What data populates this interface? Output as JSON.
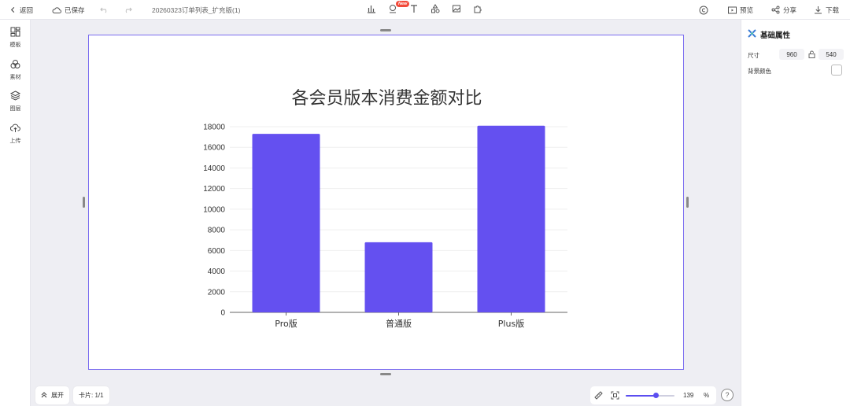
{
  "topbar": {
    "back_label": "返回",
    "saved_label": "已保存",
    "doc_title": "20260323订单列表_扩充版(1)",
    "new_badge": "New",
    "preview_label": "预览",
    "share_label": "分享",
    "download_label": "下载"
  },
  "sidebar": {
    "items": [
      {
        "label": "模板",
        "icon": "template-icon"
      },
      {
        "label": "素材",
        "icon": "assets-icon"
      },
      {
        "label": "图层",
        "icon": "layers-icon"
      },
      {
        "label": "上传",
        "icon": "upload-icon"
      }
    ]
  },
  "right_panel": {
    "title": "基础属性",
    "size_label": "尺寸",
    "width": "960",
    "height": "540",
    "bg_color_label": "背景颜色",
    "bg_color": "#ffffff"
  },
  "bottom": {
    "expand_label": "展开",
    "card_label": "卡片: 1/1",
    "zoom_value": "139",
    "zoom_percent_sign": "%",
    "zoom_fraction": 0.62,
    "help_label": "?"
  },
  "colors": {
    "accent": "#5b4ef0",
    "bar": "#6450f0",
    "canvas_border": "#7a6cf0",
    "new_badge": "#f24a3a"
  },
  "chart_data": {
    "type": "bar",
    "title": "各会员版本消费金额对比",
    "categories": [
      "Pro版",
      "普通版",
      "Plus版"
    ],
    "values": [
      17300,
      6800,
      18100
    ],
    "ylim": [
      0,
      18000
    ],
    "yticks": [
      0,
      2000,
      4000,
      6000,
      8000,
      10000,
      12000,
      14000,
      16000,
      18000
    ],
    "xlabel": "",
    "ylabel": "",
    "grid": true,
    "legend": "none"
  }
}
